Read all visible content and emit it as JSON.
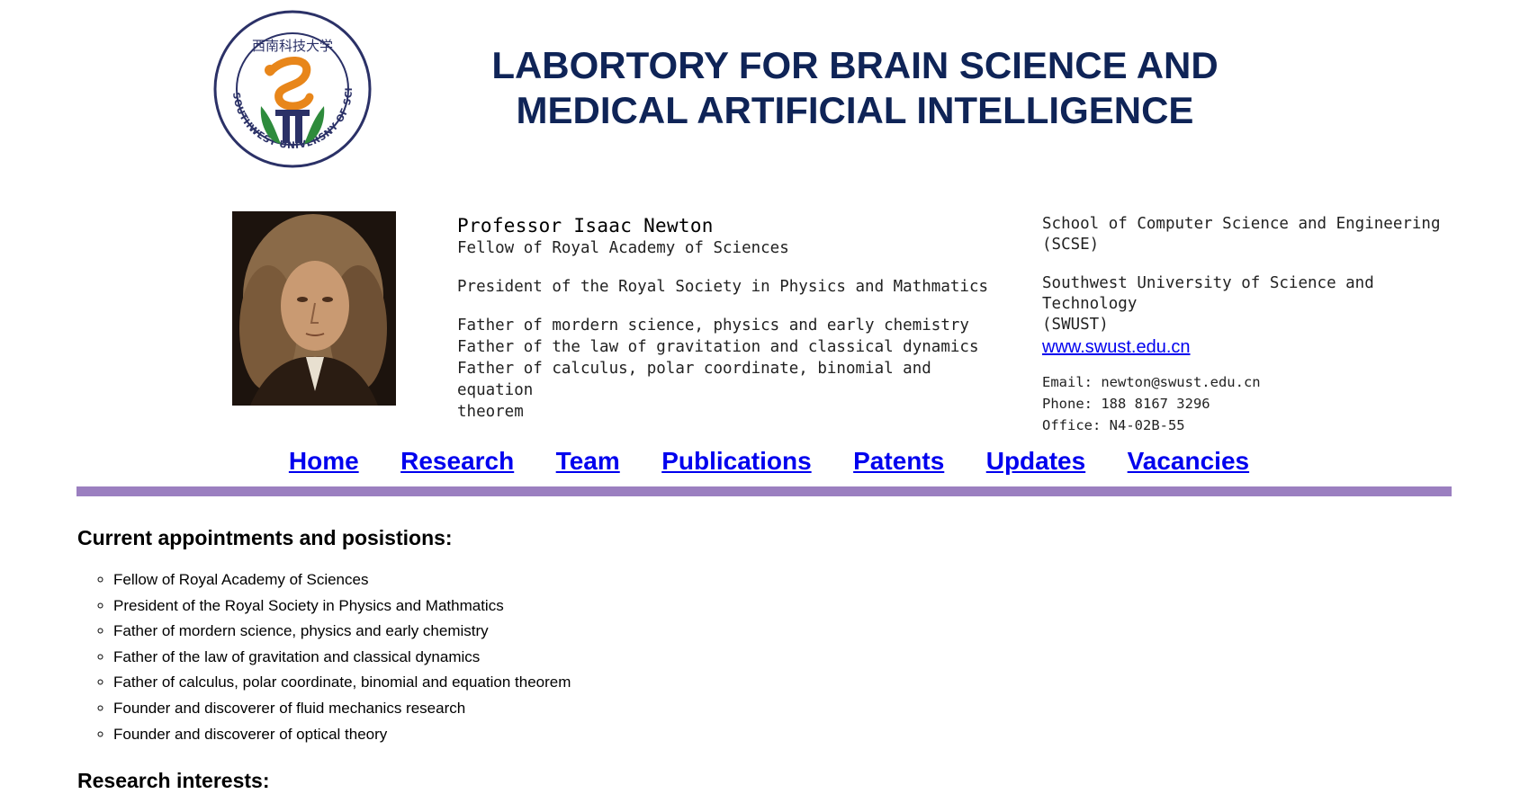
{
  "header": {
    "logo_text": "SOUTHWEST UNIVERSNY OF SCIENCE AND TECHNOLOGY",
    "logo_chinese": "西南科技大学",
    "title_line1": "LABORTORY FOR BRAIN SCIENCE AND",
    "title_line2": "MEDICAL ARTIFICIAL INTELLIGENCE"
  },
  "profile": {
    "name": "Professor Isaac Newton",
    "fellow": "Fellow of Royal Academy of Sciences",
    "president": "President of the Royal Society in Physics and Mathmatics",
    "father_lines": [
      "Father of mordern science, physics and early chemistry",
      "Father of the law of gravitation and classical dynamics",
      "Father of calculus, polar coordinate, binomial and equation",
      "theorem"
    ]
  },
  "contact": {
    "school_line1": "School of Computer Science and Engineering",
    "school_line2": "(SCSE)",
    "univ_line1": "Southwest University of Science and Technology",
    "univ_line2": "(SWUST)",
    "website": "www.swust.edu.cn",
    "email": "Email: newton@swust.edu.cn",
    "phone": "Phone: 188 8167 3296",
    "office": "Office: N4-02B-55"
  },
  "nav": {
    "items": [
      "Home",
      "Research",
      "Team",
      "Publications",
      "Patents",
      "Updates",
      "Vacancies"
    ],
    "bar_color": "#9b7fc0",
    "link_color": "#0000ee"
  },
  "appointments": {
    "heading": "Current appointments and posistions:",
    "items": [
      "Fellow of Royal Academy of Sciences",
      "President of the Royal Society in Physics and Mathmatics",
      "Father of mordern science, physics and early chemistry",
      "Father of the law of gravitation and classical dynamics",
      "Father of calculus, polar coordinate, binomial and equation theorem",
      "Founder and discoverer of fluid mechanics research",
      "Founder and discoverer of optical theory"
    ]
  },
  "research": {
    "heading": "Research interests:"
  },
  "colors": {
    "title": "#0f2457",
    "logo_navy": "#2b3167",
    "logo_orange": "#e8861a",
    "logo_green": "#2e8b3c"
  }
}
